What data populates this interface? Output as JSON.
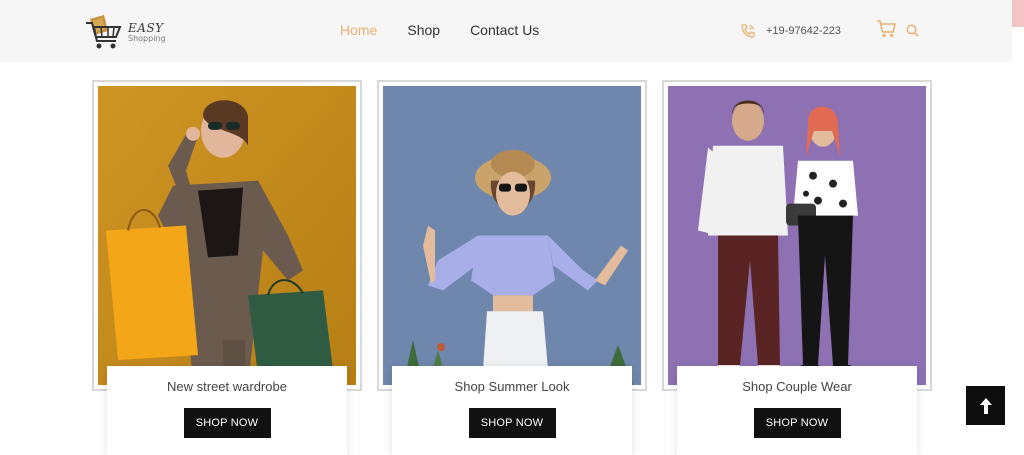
{
  "logo": {
    "line1": "EASY",
    "line2": "Shopping"
  },
  "nav": {
    "items": [
      {
        "label": "Home",
        "active": true
      },
      {
        "label": "Shop"
      },
      {
        "label": "Contact Us"
      }
    ]
  },
  "contact": {
    "phone": "+19-97642-223"
  },
  "icons": {
    "phone": "phone-icon",
    "cart": "cart-icon",
    "search": "search-icon",
    "back_to_top": "arrow-up-icon"
  },
  "colors": {
    "accent": "#e8b071",
    "button": "#111111",
    "header_bg": "#f6f6f6"
  },
  "cards": [
    {
      "title": "New street wardrobe",
      "button": "SHOP NOW"
    },
    {
      "title": "Shop Summer Look",
      "button": "SHOP NOW"
    },
    {
      "title": "Shop Couple Wear",
      "button": "SHOP NOW"
    }
  ]
}
